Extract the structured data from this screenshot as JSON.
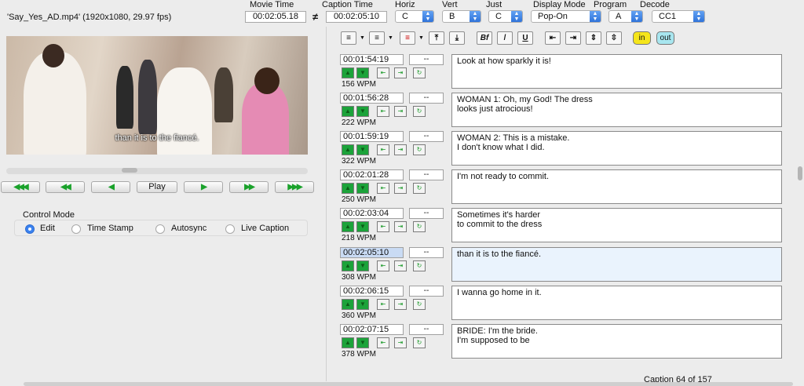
{
  "file_info": "'Say_Yes_AD.mp4'  (1920x1080, 29.97 fps)",
  "fields": {
    "movie_time": {
      "label": "Movie Time",
      "value": "00:02:05.18"
    },
    "neq_symbol": "≠",
    "caption_time": {
      "label": "Caption Time",
      "value": "00:02:05:10"
    },
    "horiz": {
      "label": "Horiz",
      "value": "C"
    },
    "vert": {
      "label": "Vert",
      "value": "B"
    },
    "just": {
      "label": "Just",
      "value": "C"
    },
    "display_mode": {
      "label": "Display Mode",
      "value": "Pop-On"
    },
    "program": {
      "label": "Program",
      "value": "A"
    },
    "decode": {
      "label": "Decode",
      "value": "CC1"
    }
  },
  "video": {
    "subtitle": "than it is to the fiancé."
  },
  "transport": {
    "btn1": "◀◀◀",
    "btn2": "◀◀",
    "btn3": "◀",
    "play": "Play",
    "btn5": "▶",
    "btn6": "▶▶",
    "btn7": "▶▶▶"
  },
  "control_mode": {
    "label": "Control Mode",
    "options": [
      "Edit",
      "Time Stamp",
      "Autosync",
      "Live Caption"
    ],
    "selected": "Edit"
  },
  "toolbar": {
    "in_label": "in",
    "out_label": "out",
    "underline_label": "U",
    "bf_label": "Bf"
  },
  "rows": [
    {
      "time": "00:01:54:19",
      "dash": "--",
      "wpm": "156 WPM",
      "text": "Look at how sparkly it is!"
    },
    {
      "time": "00:01:56:28",
      "dash": "--",
      "wpm": "222 WPM",
      "text": "WOMAN 1: Oh, my God! The dress\nlooks just atrocious!"
    },
    {
      "time": "00:01:59:19",
      "dash": "--",
      "wpm": "322 WPM",
      "text": "WOMAN 2: This is a mistake.\nI don't know what I did."
    },
    {
      "time": "00:02:01:28",
      "dash": "--",
      "wpm": "250 WPM",
      "text": "I'm not ready to commit."
    },
    {
      "time": "00:02:03:04",
      "dash": "--",
      "wpm": "218 WPM",
      "text": "Sometimes it's harder\nto commit to the dress"
    },
    {
      "time": "00:02:05:10",
      "dash": "--",
      "wpm": "308 WPM",
      "text": "than it is to the fiancé."
    },
    {
      "time": "00:02:06:15",
      "dash": "--",
      "wpm": "360 WPM",
      "text": "I wanna go home in it."
    },
    {
      "time": "00:02:07:15",
      "dash": "--",
      "wpm": "378 WPM",
      "text": "BRIDE: I'm the bride.\nI'm supposed to be"
    }
  ],
  "selected_row": 5,
  "footer": "Caption 64 of 157"
}
